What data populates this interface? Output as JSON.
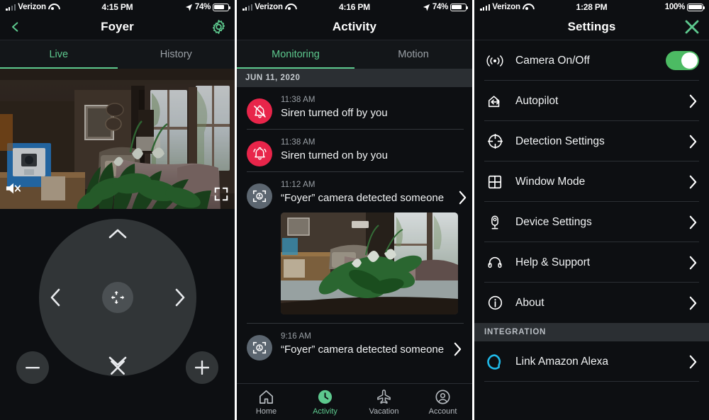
{
  "panels": {
    "live": {
      "status_bar": {
        "carrier": "Verizon",
        "time": "4:15 PM",
        "battery_pct": "74%",
        "signal_icon": "cellular-bars-icon",
        "wifi_icon": "wifi-icon",
        "location_icon": "location-arrow-icon",
        "battery_icon": "battery-icon"
      },
      "nav": {
        "title": "Foyer",
        "back_icon": "chevron-left-icon",
        "settings_icon": "gear-icon"
      },
      "tabs": [
        {
          "label": "Live",
          "active": true
        },
        {
          "label": "History",
          "active": false
        }
      ],
      "video": {
        "mute_icon": "speaker-muted-icon",
        "fullscreen_icon": "fullscreen-expand-icon",
        "alt": "live camera view of living room with windows, couch and plants"
      },
      "ptz": {
        "up_icon": "chevron-up-icon",
        "down_icon": "chevron-down-icon",
        "left_icon": "chevron-left-icon",
        "right_icon": "chevron-right-icon",
        "center_icon": "recenter-icon",
        "zoom_out_icon": "minus-icon",
        "close_icon": "close-x-icon",
        "zoom_in_icon": "plus-icon"
      }
    },
    "activity": {
      "status_bar": {
        "carrier": "Verizon",
        "time": "4:16 PM",
        "battery_pct": "74%",
        "signal_icon": "cellular-bars-icon",
        "wifi_icon": "wifi-icon",
        "location_icon": "location-arrow-icon",
        "battery_icon": "battery-icon"
      },
      "nav": {
        "title": "Activity"
      },
      "tabs": [
        {
          "label": "Monitoring",
          "active": true
        },
        {
          "label": "Motion",
          "active": false
        }
      ],
      "date_header": "JUN 11, 2020",
      "events": [
        {
          "time": "11:38 AM",
          "text": "Siren turned off by you",
          "icon": "bell-slash-icon",
          "icon_color": "#e8254a",
          "has_chevron": false,
          "has_thumb": false
        },
        {
          "time": "11:38 AM",
          "text": "Siren turned on by you",
          "icon": "bell-ringing-icon",
          "icon_color": "#e8254a",
          "has_chevron": false,
          "has_thumb": false
        },
        {
          "time": "11:12 AM",
          "text": "“Foyer” camera detected someone",
          "icon": "person-detect-icon",
          "icon_color": "#5c6670",
          "has_chevron": true,
          "has_thumb": true
        },
        {
          "time": "9:16 AM",
          "text": "“Foyer” camera detected someone",
          "icon": "person-detect-icon",
          "icon_color": "#5c6670",
          "has_chevron": true,
          "has_thumb": false
        }
      ],
      "tabbar": [
        {
          "label": "Home",
          "icon": "home-icon",
          "active": false
        },
        {
          "label": "Activity",
          "icon": "clock-icon",
          "active": true
        },
        {
          "label": "Vacation",
          "icon": "airplane-icon",
          "active": false
        },
        {
          "label": "Account",
          "icon": "person-circle-icon",
          "active": false
        }
      ]
    },
    "settings": {
      "status_bar": {
        "carrier": "Verizon",
        "time": "1:28 PM",
        "battery_pct": "100%",
        "signal_icon": "cellular-bars-icon",
        "wifi_icon": "wifi-icon",
        "battery_icon": "battery-icon"
      },
      "nav": {
        "title": "Settings",
        "close_icon": "close-x-icon"
      },
      "rows": [
        {
          "label": "Camera On/Off",
          "icon": "broadcast-signal-icon",
          "control": "toggle",
          "toggle_on": true
        },
        {
          "label": "Autopilot",
          "icon": "home-arrows-icon",
          "control": "chevron"
        },
        {
          "label": "Detection Settings",
          "icon": "target-circle-icon",
          "control": "chevron"
        },
        {
          "label": "Window Mode",
          "icon": "window-grid-icon",
          "control": "chevron"
        },
        {
          "label": "Device Settings",
          "icon": "camera-device-icon",
          "control": "chevron"
        },
        {
          "label": "Help & Support",
          "icon": "headset-icon",
          "control": "chevron"
        },
        {
          "label": "About",
          "icon": "info-circle-icon",
          "control": "chevron"
        }
      ],
      "section_header": "INTEGRATION",
      "integration_rows": [
        {
          "label": "Link Amazon Alexa",
          "icon": "alexa-icon",
          "control": "chevron"
        }
      ]
    }
  },
  "colors": {
    "accent_green": "#5dc98e",
    "toggle_green": "#4cbb63",
    "alert_red": "#e8254a",
    "detect_gray": "#5c6670",
    "alexa_cyan": "#20b9e8",
    "background": "#0d0f12",
    "section_bar": "#2b2f33"
  }
}
